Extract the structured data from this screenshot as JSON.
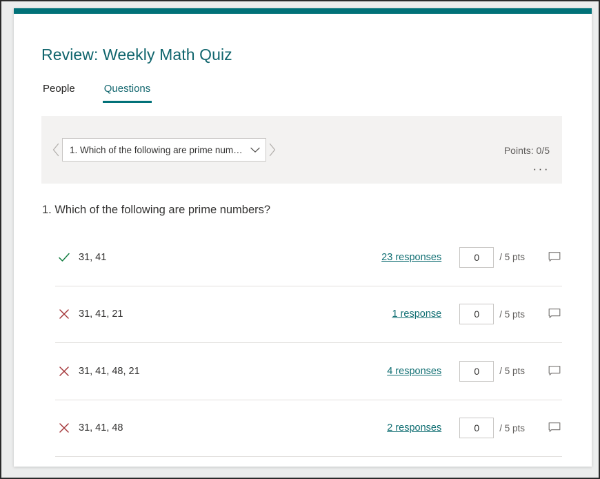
{
  "window": {
    "accent_color": "#017178"
  },
  "header": {
    "title": "Review: Weekly Math Quiz"
  },
  "tabs": [
    {
      "label": "People",
      "active": false
    },
    {
      "label": "Questions",
      "active": true
    }
  ],
  "selector": {
    "prev_icon": "chevron-left-icon",
    "next_icon": "chevron-right-icon",
    "dropdown_value": "1. Which of the following are prime num…",
    "dropdown_caret_icon": "chevron-down-icon",
    "points_label": "Points: 0/5",
    "more_label": "···"
  },
  "question": {
    "heading": "1. Which of the following are prime numbers?",
    "answers": [
      {
        "status": "correct",
        "status_icon": "check-icon",
        "text": "31, 41",
        "responses_label": "23 responses",
        "responses_count": 23,
        "score_value": "0",
        "score_suffix": "/ 5 pts",
        "comment_icon": "comment-bubble-icon"
      },
      {
        "status": "incorrect",
        "status_icon": "cross-icon",
        "text": "31, 41, 21",
        "responses_label": "1 response",
        "responses_count": 1,
        "score_value": "0",
        "score_suffix": "/ 5 pts",
        "comment_icon": "comment-bubble-icon"
      },
      {
        "status": "incorrect",
        "status_icon": "cross-icon",
        "text": "31, 41, 48, 21",
        "responses_label": "4 responses",
        "responses_count": 4,
        "score_value": "0",
        "score_suffix": "/ 5 pts",
        "comment_icon": "comment-bubble-icon"
      },
      {
        "status": "incorrect",
        "status_icon": "cross-icon",
        "text": "31, 41, 48",
        "responses_label": "2 responses",
        "responses_count": 2,
        "score_value": "0",
        "score_suffix": "/ 5 pts",
        "comment_icon": "comment-bubble-icon"
      }
    ]
  },
  "colors": {
    "accent": "#017178",
    "link": "#0f6e72",
    "correct": "#107c3f",
    "incorrect": "#a4373a",
    "panel": "#f3f2f1"
  }
}
